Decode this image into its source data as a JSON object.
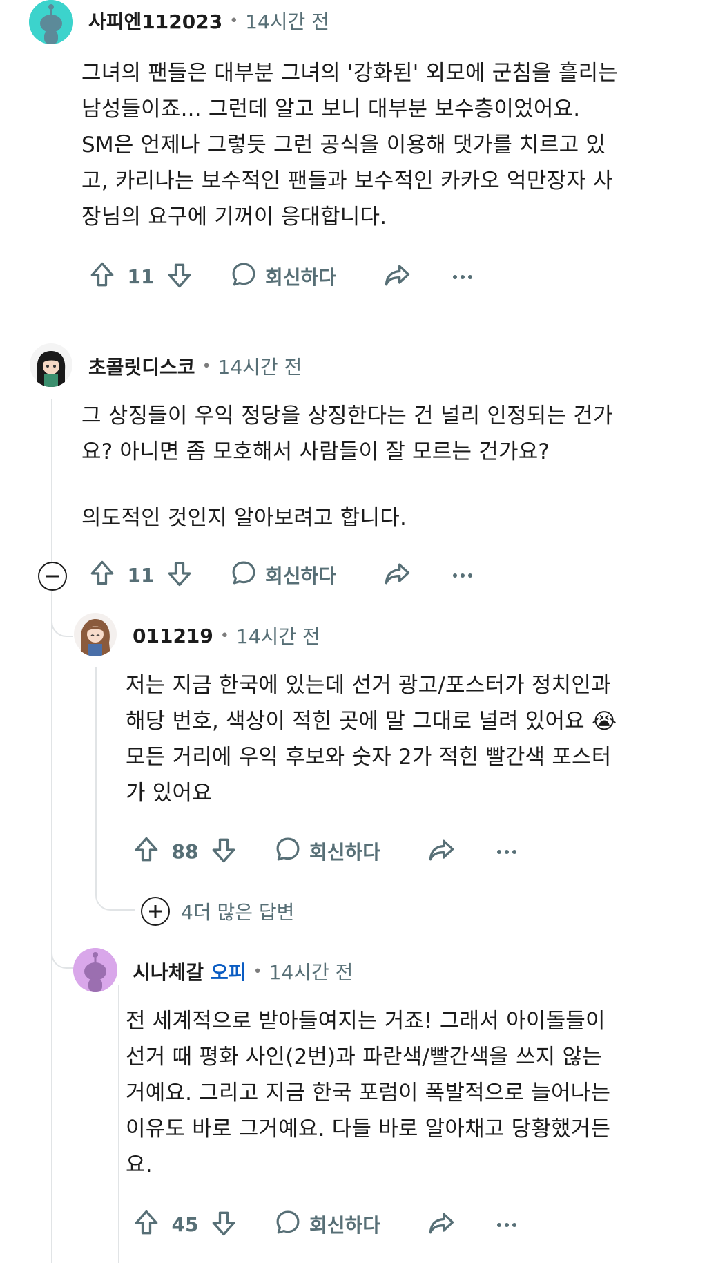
{
  "comments": [
    {
      "username": "사피엔112023",
      "op_badge": "",
      "time": "14시간 전",
      "body": [
        "그녀의 팬들은 대부분 그녀의 '강화된' 외모에 군침을 흘리는",
        "남성들이죠... 그런데 알고 보니 대부분 보수층이었어요.",
        "SM은 언제나 그렇듯 그런 공식을 이용해 댓가를 치르고 있",
        "고, 카리나는 보수적인 팬들과 보수적인 카카오 억만장자 사",
        "장님의 요구에 기꺼이 응대합니다."
      ],
      "votes": "11",
      "reply_label": "회신하다",
      "avatar_color": "#3cd3cc"
    },
    {
      "username": "초콜릿디스코",
      "op_badge": "",
      "time": "14시간 전",
      "body": [
        "그 상징들이 우익 정당을 상징한다는 건 널리 인정되는 건가",
        "요? 아니면 좀 모호해서 사람들이 잘 모르는 건가요?",
        "",
        "의도적인 것인지 알아보려고 합니다."
      ],
      "votes": "11",
      "reply_label": "회신하다"
    },
    {
      "username": "011219",
      "op_badge": "",
      "time": "14시간 전",
      "body": [
        "저는 지금 한국에 있는데 선거 광고/포스터가 정치인과",
        "해당 번호, 색상이 적힌 곳에 말 그대로 널려 있어요 😭",
        "모든 거리에 우익 후보와 숫자 2가 적힌 빨간색 포스터",
        "가 있어요"
      ],
      "votes": "88",
      "reply_label": "회신하다"
    },
    {
      "username": "시나체갈",
      "op_badge": "오피",
      "time": "14시간 전",
      "body": [
        "전 세계적으로 받아들여지는 거죠! 그래서 아이돌들이",
        "선거 때 평화 사인(2번)과 파란색/빨간색을 쓰지 않는",
        "거예요. 그리고 지금 한국 포럼이 폭발적으로 늘어나는",
        "이유도 바로 그거예요. 다들 바로 알아채고 당황했거든",
        "요."
      ],
      "votes": "45",
      "reply_label": "회신하다",
      "avatar_color": "#d9a7ea"
    }
  ],
  "more_replies": "4더 많은 답변",
  "meta_separator": "•",
  "icons": {
    "upvote": "upvote-icon",
    "downvote": "downvote-icon",
    "reply": "reply-bubble-icon",
    "share": "share-arrow-icon",
    "more": "more-dots-icon",
    "collapse": "collapse-minus-icon",
    "expand": "expand-plus-icon"
  }
}
